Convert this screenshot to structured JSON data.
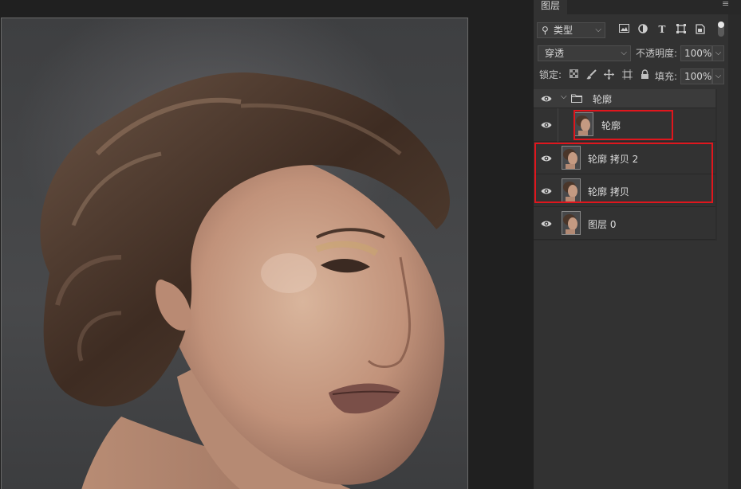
{
  "panel": {
    "tab_title": "图层",
    "filter": {
      "label": "类型"
    },
    "blend_mode": "穿透",
    "opacity_label": "不透明度:",
    "opacity_value": "100%",
    "lock_label": "锁定:",
    "fill_label": "填充:",
    "fill_value": "100%"
  },
  "layers": [
    {
      "name": "轮廓",
      "kind": "group"
    },
    {
      "name": "轮廓"
    },
    {
      "name": "轮廓 拷贝 2"
    },
    {
      "name": "轮廓 拷贝"
    },
    {
      "name": "图层 0"
    }
  ],
  "colors": {
    "annotation": "#e0161d",
    "panel_bg": "#323232",
    "canvas_bg": "#202020"
  },
  "icons": [
    "search-icon",
    "image-filter-icon",
    "adjustment-filter-icon",
    "type-filter-icon",
    "shape-filter-icon",
    "smart-object-filter-icon",
    "lock-transparent-icon",
    "lock-paint-icon",
    "lock-move-icon",
    "lock-artboard-icon",
    "lock-all-icon",
    "eye-icon",
    "folder-icon",
    "chevron-down-icon",
    "panel-menu-icon"
  ]
}
